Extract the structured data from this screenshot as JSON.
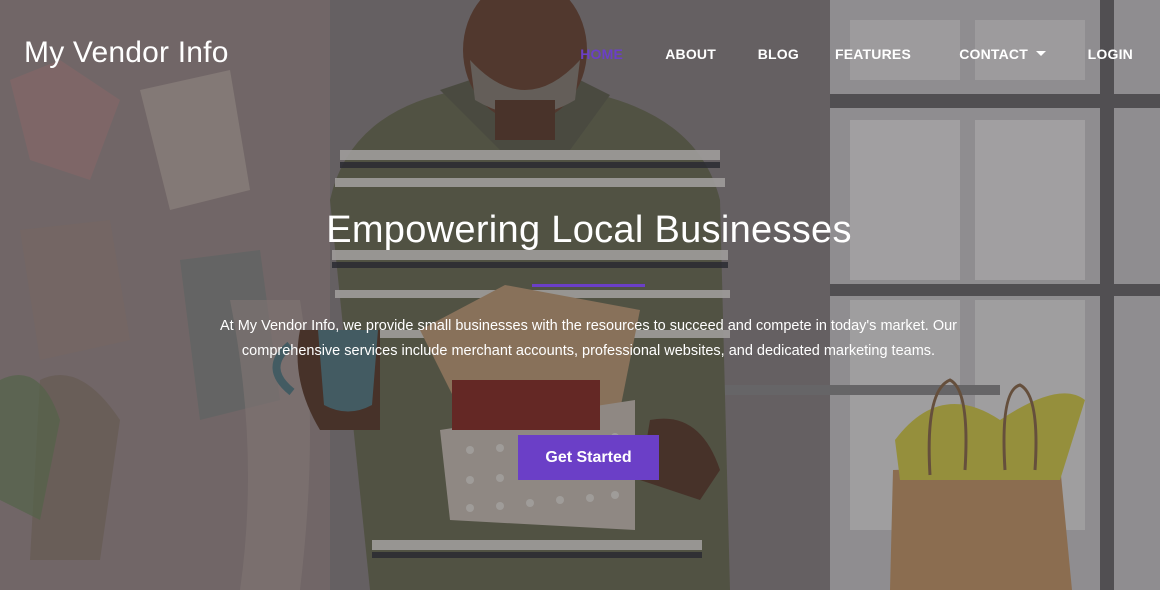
{
  "brand": {
    "name": "My Vendor Info"
  },
  "nav": {
    "items": [
      {
        "label": "HOME",
        "active": true
      },
      {
        "label": "ABOUT"
      },
      {
        "label": "BLOG"
      },
      {
        "label": "FEATURES"
      },
      {
        "label": "CONTACT",
        "dropdown": true,
        "icon": "caret-down-icon"
      },
      {
        "label": "LOGIN"
      }
    ]
  },
  "hero": {
    "title": "Empowering Local Businesses",
    "text": "At My Vendor Info, we provide small businesses with the resources to succeed and compete in today's market. Our comprehensive services include merchant accounts, professional websites, and dedicated marketing teams.",
    "cta_label": "Get Started",
    "background_image": "smiling man in striped polo holding an open gift box and a blue mug in a bright studio"
  },
  "colors": {
    "accent": "#6b3fc7",
    "text": "#ffffff"
  }
}
